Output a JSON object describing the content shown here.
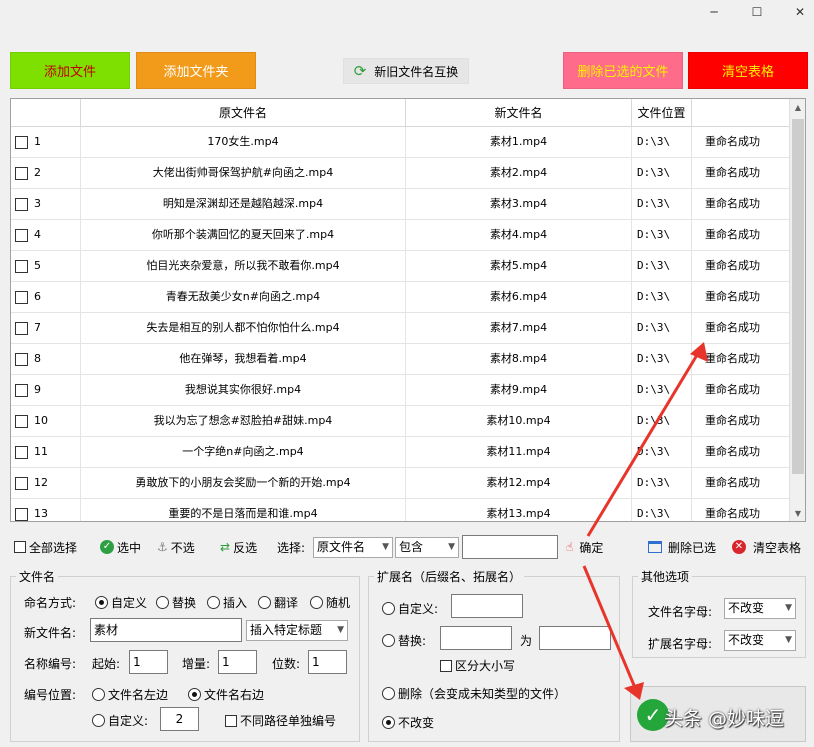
{
  "colors": {
    "add_file": "#7ee000",
    "add_folder": "#f29a1a",
    "delete_selected": "#ff6b8a",
    "clear_table": "#ff0000",
    "arrow": "#e8352c"
  },
  "window": {
    "minimize": "─",
    "maximize": "☐",
    "close": "✕"
  },
  "toolbar": {
    "add_file": "添加文件",
    "add_folder": "添加文件夹",
    "swap": "新旧文件名互换",
    "delete_selected": "删除已选的文件",
    "clear_table": "清空表格"
  },
  "table": {
    "headers": [
      "原文件名",
      "新文件名",
      "文件位置"
    ],
    "rows": [
      {
        "no": "1",
        "orig": "170女生.mp4",
        "new": "素材1.mp4",
        "loc": "D:\\3\\",
        "status": "重命名成功"
      },
      {
        "no": "2",
        "orig": "大佬出街帅哥保驾护航#向函之.mp4",
        "new": "素材2.mp4",
        "loc": "D:\\3\\",
        "status": "重命名成功"
      },
      {
        "no": "3",
        "orig": "明知是深渊却还是越陷越深.mp4",
        "new": "素材3.mp4",
        "loc": "D:\\3\\",
        "status": "重命名成功"
      },
      {
        "no": "4",
        "orig": "你听那个装满回忆的夏天回来了.mp4",
        "new": "素材4.mp4",
        "loc": "D:\\3\\",
        "status": "重命名成功"
      },
      {
        "no": "5",
        "orig": "怕目光夹杂爱意，所以我不敢看你.mp4",
        "new": "素材5.mp4",
        "loc": "D:\\3\\",
        "status": "重命名成功"
      },
      {
        "no": "6",
        "orig": "青春无敌美少女n#向函之.mp4",
        "new": "素材6.mp4",
        "loc": "D:\\3\\",
        "status": "重命名成功"
      },
      {
        "no": "7",
        "orig": "失去是相互的别人都不怕你怕什么.mp4",
        "new": "素材7.mp4",
        "loc": "D:\\3\\",
        "status": "重命名成功"
      },
      {
        "no": "8",
        "orig": "他在弹琴，我想看着.mp4",
        "new": "素材8.mp4",
        "loc": "D:\\3\\",
        "status": "重命名成功"
      },
      {
        "no": "9",
        "orig": "我想说其实你很好.mp4",
        "new": "素材9.mp4",
        "loc": "D:\\3\\",
        "status": "重命名成功"
      },
      {
        "no": "10",
        "orig": "我以为忘了想念#怼脸拍#甜妹.mp4",
        "new": "素材10.mp4",
        "loc": "D:\\3\\",
        "status": "重命名成功"
      },
      {
        "no": "11",
        "orig": "一个字绝n#向函之.mp4",
        "new": "素材11.mp4",
        "loc": "D:\\3\\",
        "status": "重命名成功"
      },
      {
        "no": "12",
        "orig": "勇敢放下的小朋友会奖励一个新的开始.mp4",
        "new": "素材12.mp4",
        "loc": "D:\\3\\",
        "status": "重命名成功"
      },
      {
        "no": "13",
        "orig": "重要的不是日落而是和谁.mp4",
        "new": "素材13.mp4",
        "loc": "D:\\3\\",
        "status": "重命名成功"
      }
    ]
  },
  "filterbar": {
    "select_all": "全部选择",
    "select": "选中",
    "deselect": "不选",
    "invert": "反选",
    "choose": "选择:",
    "field_value": "原文件名",
    "op_value": "包含",
    "input": "",
    "confirm": "确定",
    "delete_selected": "删除已选",
    "clear_table": "清空表格"
  },
  "filename_group": {
    "title": "文件名",
    "mode_label": "命名方式:",
    "modes": [
      "自定义",
      "替换",
      "插入",
      "翻译",
      "随机"
    ],
    "new_name_label": "新文件名:",
    "new_name_value": "素材",
    "insert_title": "插入特定标题",
    "number_label": "名称编号:",
    "start_label": "起始:",
    "start_value": "1",
    "step_label": "增量:",
    "step_value": "1",
    "digits_label": "位数:",
    "digits_value": "1",
    "position_label": "编号位置:",
    "pos_left": "文件名左边",
    "pos_right": "文件名右边",
    "pos_custom": "自定义:",
    "pos_custom_value": "2",
    "per_path": "不同路径单独编号"
  },
  "ext_group": {
    "title": "扩展名（后缀名、拓展名）",
    "custom": "自定义:",
    "replace": "替换:",
    "to": "为",
    "case": "区分大小写",
    "delete": "删除（会变成未知类型的文件）",
    "nochange": "不改变"
  },
  "other_group": {
    "title": "其他选项",
    "name_case_label": "文件名字母:",
    "name_case_value": "不改变",
    "ext_case_label": "扩展名字母:",
    "ext_case_value": "不改变"
  },
  "watermark": "头条 @妙味逗"
}
